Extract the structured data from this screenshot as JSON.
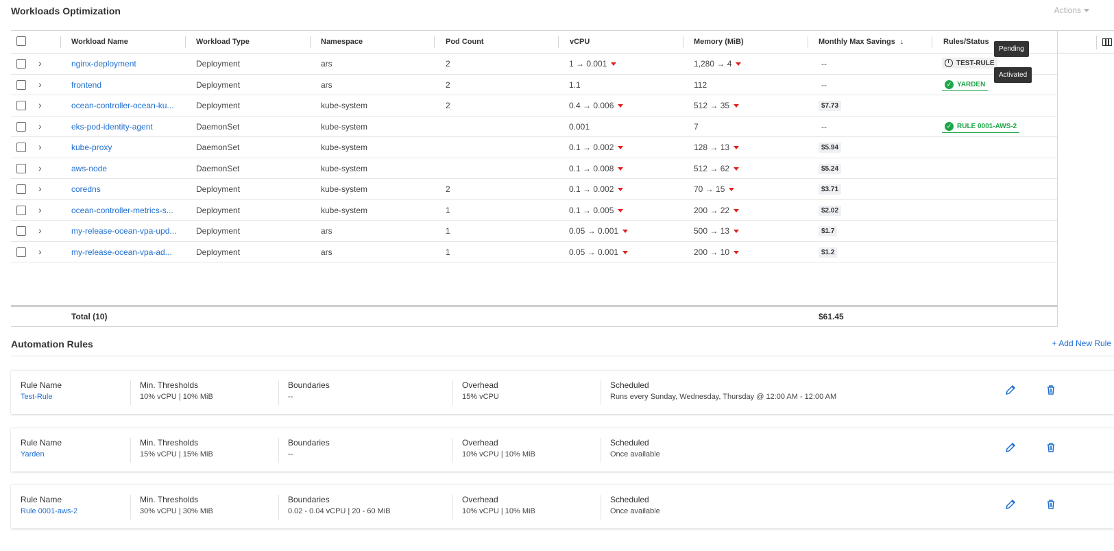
{
  "header": {
    "title": "Workloads Optimization",
    "actions_label": "Actions"
  },
  "table": {
    "columns": [
      "Workload Name",
      "Workload Type",
      "Namespace",
      "Pod Count",
      "vCPU",
      "Memory (MiB)",
      "Monthly Max Savings",
      "Rules/Status"
    ],
    "sort_indicator": "↓",
    "rows": [
      {
        "name": "nginx-deployment",
        "type": "Deployment",
        "namespace": "ars",
        "pods": "2",
        "vcpu_from": "1",
        "vcpu_to": "0.001",
        "vcpu_static": "",
        "mem_from": "1,280",
        "mem_to": "4",
        "mem_static": "",
        "savings": "--",
        "rule": "TEST-RULE",
        "rule_state": "pending"
      },
      {
        "name": "frontend",
        "type": "Deployment",
        "namespace": "ars",
        "pods": "2",
        "vcpu_from": "",
        "vcpu_to": "",
        "vcpu_static": "1.1",
        "mem_from": "",
        "mem_to": "",
        "mem_static": "112",
        "savings": "--",
        "rule": "YARDEN",
        "rule_state": "active"
      },
      {
        "name": "ocean-controller-ocean-ku...",
        "type": "Deployment",
        "namespace": "kube-system",
        "pods": "2",
        "vcpu_from": "0.4",
        "vcpu_to": "0.006",
        "vcpu_static": "",
        "mem_from": "512",
        "mem_to": "35",
        "mem_static": "",
        "savings": "$7.73",
        "rule": "",
        "rule_state": ""
      },
      {
        "name": "eks-pod-identity-agent",
        "type": "DaemonSet",
        "namespace": "kube-system",
        "pods": "",
        "vcpu_from": "",
        "vcpu_to": "",
        "vcpu_static": "0.001",
        "mem_from": "",
        "mem_to": "",
        "mem_static": "7",
        "savings": "--",
        "rule": "RULE 0001-AWS-2",
        "rule_state": "active"
      },
      {
        "name": "kube-proxy",
        "type": "DaemonSet",
        "namespace": "kube-system",
        "pods": "",
        "vcpu_from": "0.1",
        "vcpu_to": "0.002",
        "vcpu_static": "",
        "mem_from": "128",
        "mem_to": "13",
        "mem_static": "",
        "savings": "$5.94",
        "rule": "",
        "rule_state": ""
      },
      {
        "name": "aws-node",
        "type": "DaemonSet",
        "namespace": "kube-system",
        "pods": "",
        "vcpu_from": "0.1",
        "vcpu_to": "0.008",
        "vcpu_static": "",
        "mem_from": "512",
        "mem_to": "62",
        "mem_static": "",
        "savings": "$5.24",
        "rule": "",
        "rule_state": ""
      },
      {
        "name": "coredns",
        "type": "Deployment",
        "namespace": "kube-system",
        "pods": "2",
        "vcpu_from": "0.1",
        "vcpu_to": "0.002",
        "vcpu_static": "",
        "mem_from": "70",
        "mem_to": "15",
        "mem_static": "",
        "savings": "$3.71",
        "rule": "",
        "rule_state": ""
      },
      {
        "name": "ocean-controller-metrics-s...",
        "type": "Deployment",
        "namespace": "kube-system",
        "pods": "1",
        "vcpu_from": "0.1",
        "vcpu_to": "0.005",
        "vcpu_static": "",
        "mem_from": "200",
        "mem_to": "22",
        "mem_static": "",
        "savings": "$2.02",
        "rule": "",
        "rule_state": ""
      },
      {
        "name": "my-release-ocean-vpa-upd...",
        "type": "Deployment",
        "namespace": "ars",
        "pods": "1",
        "vcpu_from": "0.05",
        "vcpu_to": "0.001",
        "vcpu_static": "",
        "mem_from": "500",
        "mem_to": "13",
        "mem_static": "",
        "savings": "$1.7",
        "rule": "",
        "rule_state": ""
      },
      {
        "name": "my-release-ocean-vpa-ad...",
        "type": "Deployment",
        "namespace": "ars",
        "pods": "1",
        "vcpu_from": "0.05",
        "vcpu_to": "0.001",
        "vcpu_static": "",
        "mem_from": "200",
        "mem_to": "10",
        "mem_static": "",
        "savings": "$1.2",
        "rule": "",
        "rule_state": ""
      }
    ],
    "total_label": "Total (10)",
    "total_savings": "$61.45"
  },
  "tooltips": {
    "pending": "Pending",
    "activated": "Activated"
  },
  "automation": {
    "title": "Automation Rules",
    "add_label": "+ Add New Rule",
    "headers": {
      "name": "Rule Name",
      "thresholds": "Min. Thresholds",
      "boundaries": "Boundaries",
      "overhead": "Overhead",
      "scheduled": "Scheduled"
    },
    "rules": [
      {
        "name": "Test-Rule",
        "thresholds": "10% vCPU | 10% MiB",
        "boundaries": "--",
        "overhead": "15% vCPU",
        "scheduled": "Runs every Sunday, Wednesday, Thursday @ 12:00 AM - 12:00 AM"
      },
      {
        "name": "Yarden",
        "thresholds": "15% vCPU | 15% MiB",
        "boundaries": "--",
        "overhead": "10% vCPU | 10% MiB",
        "scheduled": "Once available"
      },
      {
        "name": "Rule 0001-aws-2",
        "thresholds": "30% vCPU | 30% MiB",
        "boundaries": "0.02 - 0.04 vCPU | 20 - 60 MiB",
        "overhead": "10% vCPU | 10% MiB",
        "scheduled": "Once available"
      }
    ]
  }
}
